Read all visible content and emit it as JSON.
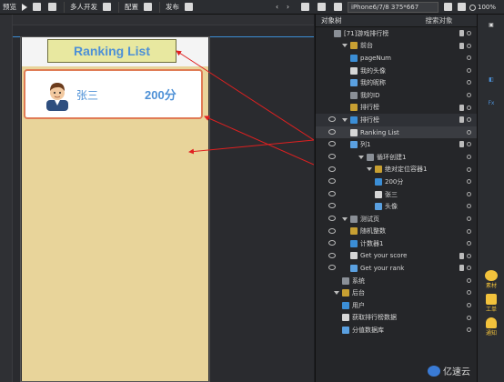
{
  "toolbar": {
    "preview": "预览",
    "multi_dev": "多人开发",
    "config": "配置",
    "publish": "发布",
    "device": "iPhone6/7/8 375*667",
    "zoom": "100%"
  },
  "phone": {
    "title": "Ranking List",
    "card_name": "张三",
    "card_score": "200分"
  },
  "panel": {
    "tab_objects": "对象树",
    "tab_search": "搜索对象",
    "rows": [
      {
        "label": "[71]游戏排行榜",
        "indent": 2
      },
      {
        "label": "前台",
        "indent": 3
      },
      {
        "label": "pageNum",
        "indent": 4
      },
      {
        "label": "我的头像",
        "indent": 4
      },
      {
        "label": "我的昵称",
        "indent": 4
      },
      {
        "label": "我的ID",
        "indent": 4
      },
      {
        "label": "排行榜",
        "indent": 4
      },
      {
        "label": "排行榜",
        "indent": 3
      },
      {
        "label": "Ranking List",
        "indent": 4
      },
      {
        "label": "列1",
        "indent": 4
      },
      {
        "label": "循环创建1",
        "indent": 5
      },
      {
        "label": "绝对定位容器1",
        "indent": 6
      },
      {
        "label": "200分",
        "indent": 7
      },
      {
        "label": "张三",
        "indent": 7
      },
      {
        "label": "头像",
        "indent": 7
      },
      {
        "label": "测试页",
        "indent": 3
      },
      {
        "label": "随机整数",
        "indent": 4
      },
      {
        "label": "计数器1",
        "indent": 4
      },
      {
        "label": "Get your score",
        "indent": 4
      },
      {
        "label": "Get your rank",
        "indent": 4
      },
      {
        "label": "系统",
        "indent": 3
      },
      {
        "label": "后台",
        "indent": 2
      },
      {
        "label": "用户",
        "indent": 3
      },
      {
        "label": "获取排行榜数据",
        "indent": 3
      },
      {
        "label": "分值数据库",
        "indent": 3
      }
    ]
  },
  "sidebar": {
    "btn1": "素材",
    "btn2": "工单",
    "btn3": "通知"
  },
  "watermark": "亿速云"
}
